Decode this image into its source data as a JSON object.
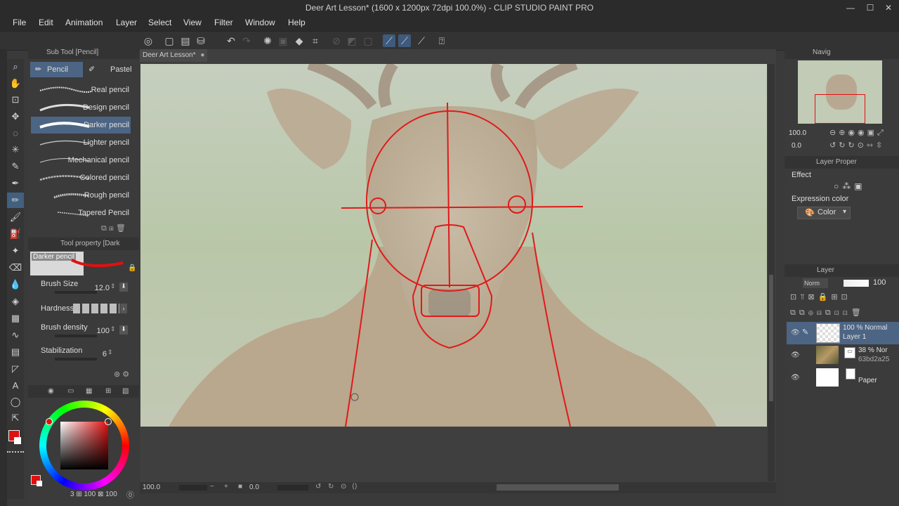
{
  "window": {
    "title": "Deer Art Lesson* (1600 x 1200px 72dpi 100.0%) - CLIP STUDIO PAINT PRO",
    "controls": [
      "—",
      "☐",
      "✕"
    ]
  },
  "menu": [
    "File",
    "Edit",
    "Animation",
    "Layer",
    "Select",
    "View",
    "Filter",
    "Window",
    "Help"
  ],
  "sub_tool": {
    "header": "Sub Tool [Pencil]",
    "tabs": [
      "Pencil",
      "Pastel"
    ],
    "brushes": [
      "Real pencil",
      "Design pencil",
      "Darker pencil",
      "Lighter pencil",
      "Mechanical pencil",
      "Colored pencil",
      "Rough pencil",
      "Tapered Pencil"
    ],
    "selected": "Darker pencil"
  },
  "tool_property": {
    "header": "Tool property [Dark",
    "preset_name": "Darker pencil",
    "brush_size_label": "Brush Size",
    "brush_size": "12.0",
    "hardness_label": "Hardness",
    "brush_density_label": "Brush density",
    "brush_density": "100",
    "stabilization_label": "Stabilization",
    "stabilization": "6"
  },
  "color": {
    "main": "#e01010",
    "sub": "#ffffff",
    "footer": "3 ⊞ 100 ⊠ 100"
  },
  "document": {
    "tab": "Deer Art Lesson*"
  },
  "status": {
    "zoom": "100.0",
    "angle": "0.0"
  },
  "navigator": {
    "header": "Navig",
    "zoom": "100.0",
    "angle": "0.0"
  },
  "layer_property": {
    "header": "Layer Proper",
    "effect_label": "Effect",
    "expression_label": "Expression color",
    "expression_value": "Color"
  },
  "layer_panel": {
    "header": "Layer",
    "blend": "Norm",
    "opacity": "100",
    "layers": [
      {
        "line1": "100 % Normal",
        "line2": "Layer 1"
      },
      {
        "line1": "38 % Nor",
        "line2": "63bd2a25"
      },
      {
        "line1": "",
        "line2": "Paper"
      }
    ]
  },
  "accent": "#4d6584",
  "sketch_color": "#e01a1a"
}
